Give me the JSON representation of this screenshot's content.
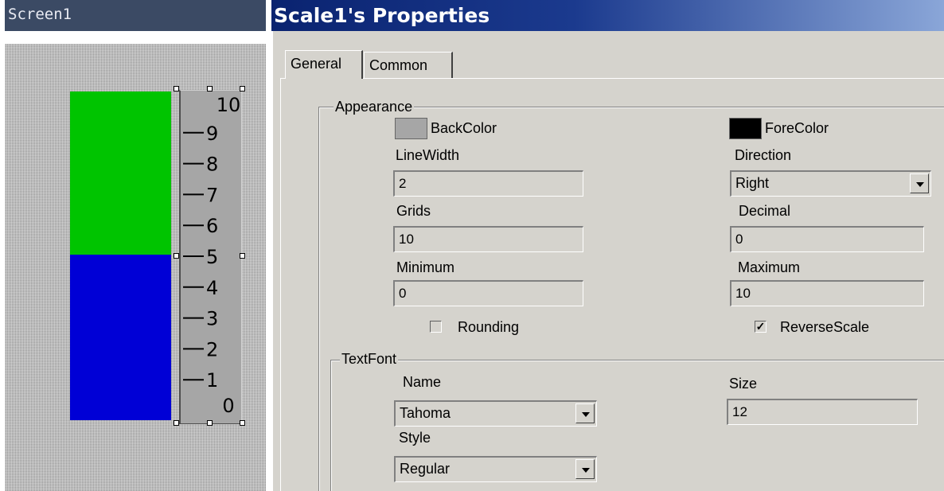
{
  "screen": {
    "title": "Screen1",
    "bar_colors": {
      "top": "#00c400",
      "bottom": "#0000d6"
    },
    "scale": {
      "min": 0,
      "max": 10,
      "labels": [
        "10",
        "9",
        "8",
        "7",
        "6",
        "5",
        "4",
        "3",
        "2",
        "1",
        "0"
      ],
      "background": "#a6a6a6"
    }
  },
  "dialog": {
    "title": "Scale1's Properties",
    "tabs": [
      {
        "label": "General",
        "selected": true
      },
      {
        "label": "Common",
        "selected": false
      }
    ],
    "appearance": {
      "group_label": "Appearance",
      "back_color_label": "BackColor",
      "back_color": "#a6a6a6",
      "fore_color_label": "ForeColor",
      "fore_color": "#000000",
      "line_width_label": "LineWidth",
      "line_width": "2",
      "direction_label": "Direction",
      "direction": "Right",
      "grids_label": "Grids",
      "grids": "10",
      "decimal_label": "Decimal",
      "decimal": "0",
      "minimum_label": "Minimum",
      "minimum": "0",
      "maximum_label": "Maximum",
      "maximum": "10",
      "rounding_label": "Rounding",
      "rounding_checked": false,
      "reverse_scale_label": "ReverseScale",
      "reverse_scale_checked": true
    },
    "text_font": {
      "group_label": "TextFont",
      "name_label": "Name",
      "name": "Tahoma",
      "size_label": "Size",
      "size": "12",
      "style_label": "Style",
      "style": "Regular"
    }
  }
}
